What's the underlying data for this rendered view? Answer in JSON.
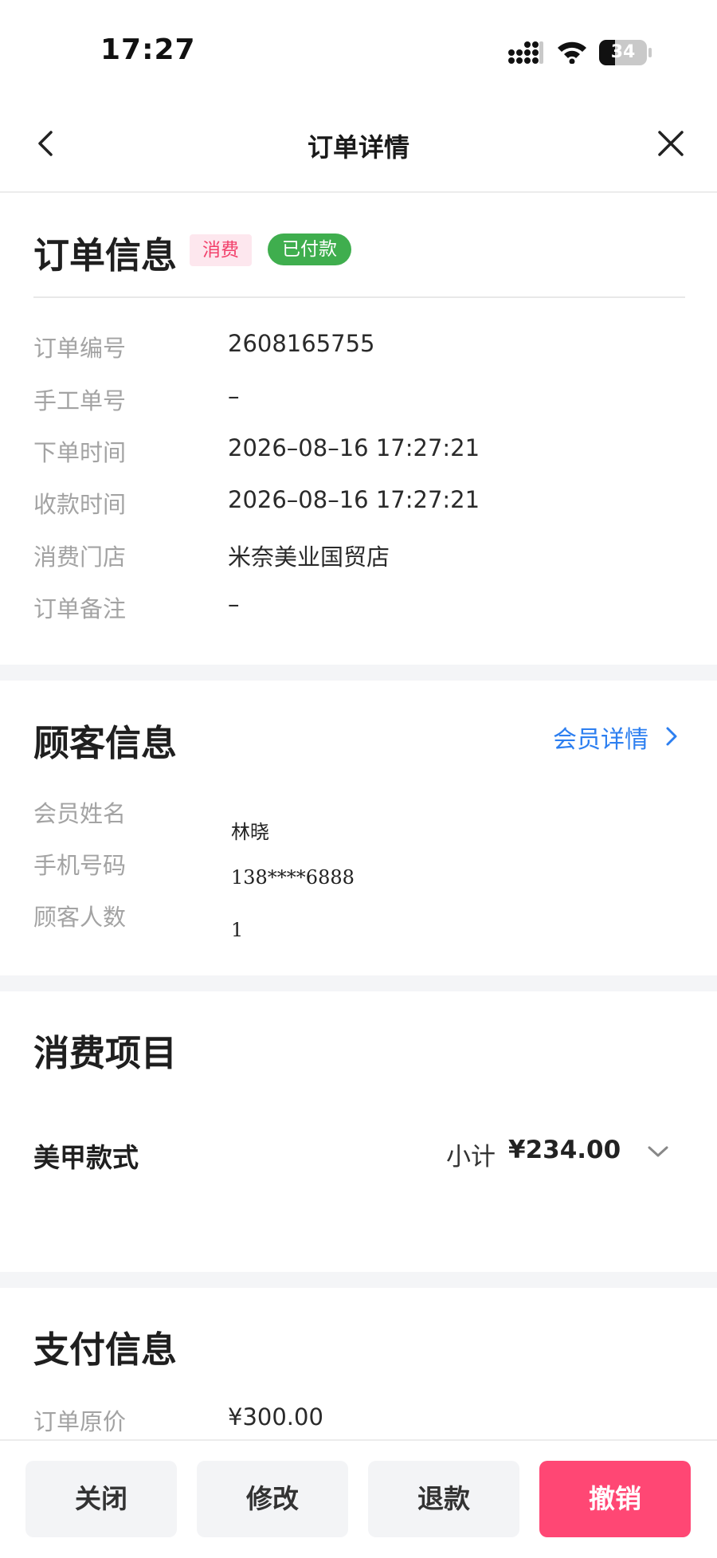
{
  "status_bar": {
    "time": "17:27",
    "battery": "34",
    "battery_level": 0.34
  },
  "nav": {
    "title": "订单详情",
    "back_icon": "chevron-left-icon",
    "close_icon": "close-icon"
  },
  "order_info": {
    "title": "订单信息",
    "tag_type": "消费",
    "tag_status": "已付款",
    "rows": [
      {
        "label": "订单编号",
        "value": "2608165755"
      },
      {
        "label": "手工单号",
        "value": "–"
      },
      {
        "label": "下单时间",
        "value": "2026–08–16 17:27:21"
      },
      {
        "label": "收款时间",
        "value": "2026–08–16 17:27:21"
      },
      {
        "label": "消费门店",
        "value": "米奈美业国贸店"
      },
      {
        "label": "订单备注",
        "value": "–"
      }
    ]
  },
  "customer_info": {
    "title": "顾客信息",
    "link": "会员详情",
    "rows": [
      {
        "label": "会员姓名",
        "value": "林晓"
      },
      {
        "label": "手机号码",
        "value": "138****6888"
      },
      {
        "label": "顾客人数",
        "value": "1"
      }
    ]
  },
  "consumption": {
    "title": "消费项目",
    "item_name": "美甲款式",
    "subtotal_label": "小计",
    "subtotal_value": "¥234.00"
  },
  "payment_info": {
    "title": "支付信息",
    "rows": [
      {
        "label": "订单原价",
        "value": "¥300.00"
      }
    ]
  },
  "actions": {
    "close": "关闭",
    "edit": "修改",
    "refund": "退款",
    "cancel": "撤销"
  },
  "colors": {
    "accent_pink": "#ff4774",
    "paid_green": "#3fae4e",
    "link_blue": "#2d7ff0"
  }
}
